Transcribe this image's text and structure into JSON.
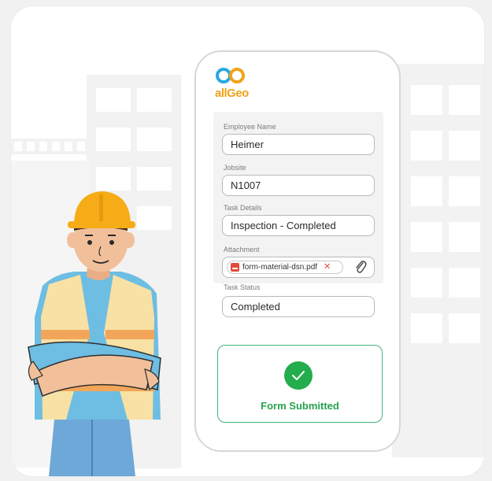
{
  "brand": {
    "logo_text": "allGeo",
    "colors": {
      "logo_blue": "#2ba8e0",
      "logo_orange": "#f0a41b",
      "accent_green": "#24ad4c"
    }
  },
  "form": {
    "fields": [
      {
        "label": "Employee Name",
        "value": "Heimer"
      },
      {
        "label": "Jobsite",
        "value": "N1007"
      },
      {
        "label": "Task Details",
        "value": "Inspection - Completed"
      }
    ],
    "attachment": {
      "label": "Attachment",
      "file_name": "form-material-dsn.pdf",
      "remove_icon": "close-icon",
      "attach_icon": "paperclip-icon"
    },
    "task_status": {
      "label": "Task Status",
      "value": "Completed"
    }
  },
  "confirmation": {
    "icon": "checkmark-icon",
    "message": "Form Submitted"
  }
}
